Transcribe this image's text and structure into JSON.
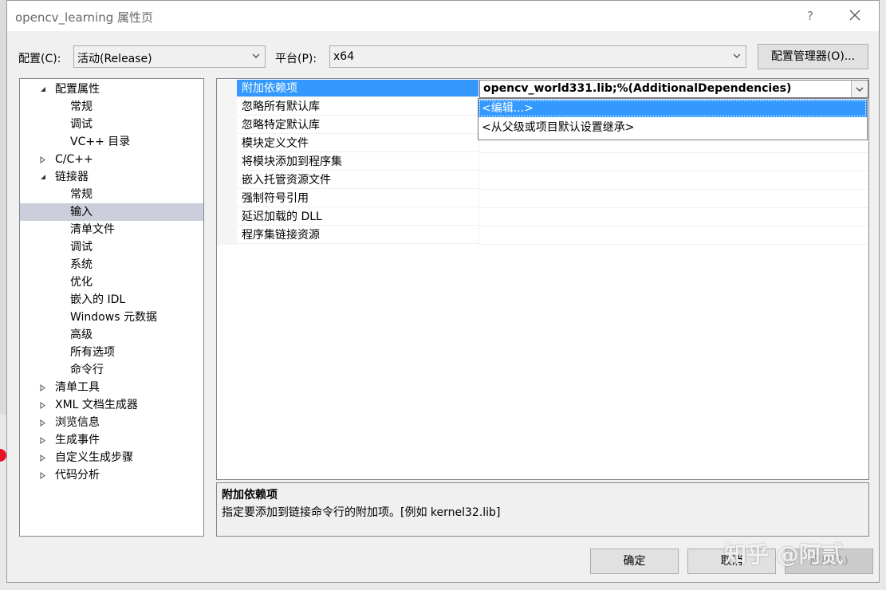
{
  "window": {
    "title": "opencv_learning 属性页",
    "help": "?"
  },
  "config_bar": {
    "config_label": "配置(C):",
    "config_value": "活动(Release)",
    "platform_label": "平台(P):",
    "platform_value": "x64",
    "manager_button": "配置管理器(O)..."
  },
  "tree": {
    "items": [
      {
        "label": "配置属性",
        "expander": "expanded"
      },
      {
        "label": "常规"
      },
      {
        "label": "调试"
      },
      {
        "label": "VC++ 目录"
      },
      {
        "label": "C/C++",
        "expander": "collapsed"
      },
      {
        "label": "链接器",
        "expander": "expanded"
      },
      {
        "label": "常规"
      },
      {
        "label": "输入",
        "selected": true
      },
      {
        "label": "清单文件"
      },
      {
        "label": "调试"
      },
      {
        "label": "系统"
      },
      {
        "label": "优化"
      },
      {
        "label": "嵌入的 IDL"
      },
      {
        "label": "Windows 元数据"
      },
      {
        "label": "高级"
      },
      {
        "label": "所有选项"
      },
      {
        "label": "命令行"
      },
      {
        "label": "清单工具",
        "expander": "collapsed"
      },
      {
        "label": "XML 文档生成器",
        "expander": "collapsed"
      },
      {
        "label": "浏览信息",
        "expander": "collapsed"
      },
      {
        "label": "生成事件",
        "expander": "collapsed"
      },
      {
        "label": "自定义生成步骤",
        "expander": "collapsed"
      },
      {
        "label": "代码分析",
        "expander": "collapsed"
      }
    ]
  },
  "grid": {
    "rows": [
      {
        "name": "附加依赖项",
        "value": "opencv_world331.lib;%(AdditionalDependencies)",
        "selected": true
      },
      {
        "name": "忽略所有默认库",
        "value": ""
      },
      {
        "name": "忽略特定默认库",
        "value": ""
      },
      {
        "name": "模块定义文件",
        "value": ""
      },
      {
        "name": "将模块添加到程序集",
        "value": ""
      },
      {
        "name": "嵌入托管资源文件",
        "value": ""
      },
      {
        "name": "强制符号引用",
        "value": ""
      },
      {
        "name": "延迟加载的 DLL",
        "value": ""
      },
      {
        "name": "程序集链接资源",
        "value": ""
      }
    ],
    "dropdown_options": [
      {
        "label": "<编辑...>",
        "highlighted": true
      },
      {
        "label": "<从父级或项目默认设置继承>"
      }
    ]
  },
  "description": {
    "title": "附加依赖项",
    "text": "指定要添加到链接命令行的附加项。[例如 kernel32.lib]"
  },
  "buttons": {
    "ok": "确定",
    "cancel": "取消",
    "apply": "应用(A)"
  },
  "watermark": "知乎 @阿贰",
  "colors": {
    "selection": "#3399ff",
    "tree_selected": "#cccedb",
    "dialog_bg": "#f0f0f0"
  }
}
